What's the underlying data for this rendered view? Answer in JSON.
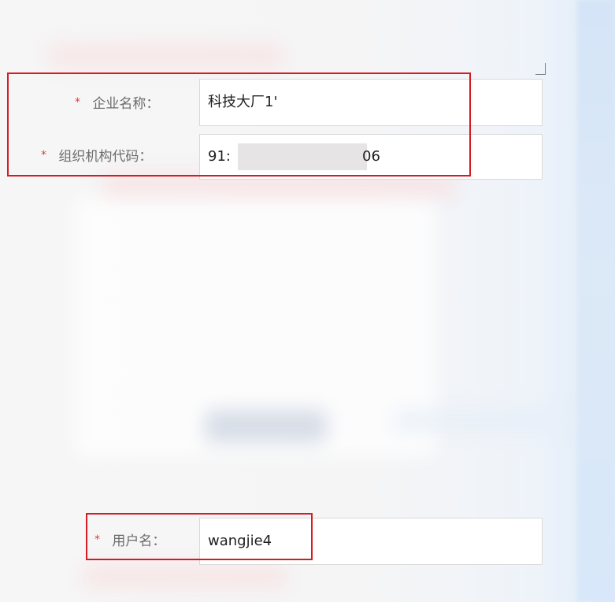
{
  "form": {
    "company_name": {
      "label": "企业名称：",
      "required_mark": "*",
      "value": "科技大厂1'"
    },
    "org_code": {
      "label": "组织机构代码：",
      "required_mark": "*",
      "value_prefix": "91:",
      "value_suffix": "06"
    },
    "username": {
      "label": "用户名：",
      "required_mark": "*",
      "value": "wangjie4"
    }
  },
  "colors": {
    "highlight": "#d71b22",
    "required": "#e23b3b"
  }
}
